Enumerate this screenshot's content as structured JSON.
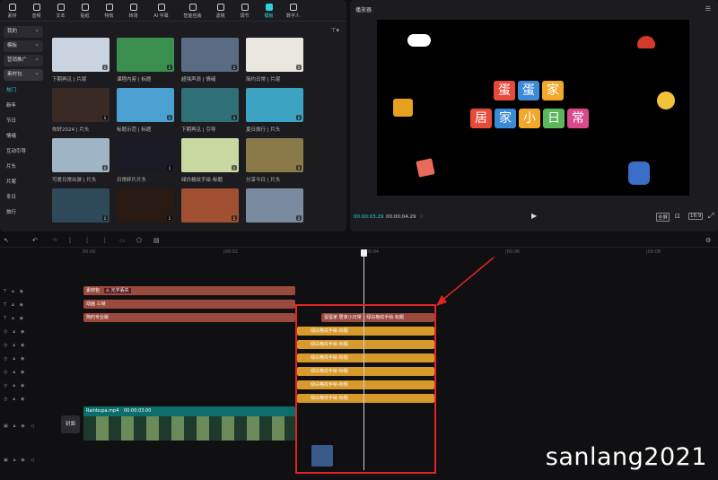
{
  "toolbar": {
    "tabs": [
      {
        "label": "素材",
        "icon": "media-icon"
      },
      {
        "label": "音频",
        "icon": "audio-icon"
      },
      {
        "label": "文本",
        "icon": "text-icon"
      },
      {
        "label": "贴纸",
        "icon": "sticker-icon"
      },
      {
        "label": "特效",
        "icon": "effects-icon"
      },
      {
        "label": "转场",
        "icon": "transition-icon"
      },
      {
        "label": "AI 字幕",
        "icon": "ai-caption-icon"
      },
      {
        "label": "智能包装",
        "icon": "smart-package-icon"
      },
      {
        "label": "滤镜",
        "icon": "filter-icon"
      },
      {
        "label": "调节",
        "icon": "adjust-icon"
      },
      {
        "label": "模板",
        "icon": "template-icon",
        "active": true
      },
      {
        "label": "数字人",
        "icon": "digital-human-icon"
      }
    ]
  },
  "sidebar": {
    "dropdowns": [
      "我的",
      "模板",
      "营销推广",
      "素材包"
    ],
    "items": [
      "热门",
      "新年",
      "节日",
      "情绪",
      "互动引导",
      "片头",
      "片尾",
      "冬日",
      "旅行"
    ]
  },
  "filter_label": "⊤▾",
  "grid": {
    "items": [
      {
        "label": "下期再见 | 片尾",
        "color": "#c9d4e0"
      },
      {
        "label": "课程内容 | 标题",
        "color": "#3b8f4e"
      },
      {
        "label": "超强声浪 | 情绪",
        "color": "#5a6c84"
      },
      {
        "label": "简约日常 | 片尾",
        "color": "#e9e6e0"
      },
      {
        "label": "你好2024 | 片头",
        "color": "#3a2a24"
      },
      {
        "label": "标题示范 | 标题",
        "color": "#4aa0d0"
      },
      {
        "label": "下期再见 | 引导",
        "color": "#2f6f78"
      },
      {
        "label": "夏日旅行 | 片头",
        "color": "#3da3c2"
      },
      {
        "label": "可爱日常出游 | 片头",
        "color": "#9fb4c4"
      },
      {
        "label": "日常碎片片头",
        "color": "#1a1a24"
      },
      {
        "label": "绿白格纹手绘-标题",
        "color": "#c8d8a0"
      },
      {
        "label": "分享今日 | 片头",
        "color": "#8a7a4a"
      },
      {
        "label": "",
        "color": "#2e4a5a"
      },
      {
        "label": "",
        "color": "#2a1a14"
      },
      {
        "label": "",
        "color": "#a05030"
      },
      {
        "label": "",
        "color": "#7a8aa0"
      }
    ]
  },
  "player": {
    "title": "播放器",
    "current_time": "00:00:03:29",
    "total_time": "00:00:04:29",
    "title_line1": "蛋蛋家",
    "title_line2": "居家小日常",
    "ratio_label": "16:9",
    "fullscreen_label": "全屏"
  },
  "timeline": {
    "ruler_ticks": [
      "00:00",
      "|00:02",
      "|00:04",
      "|00:06",
      "|00:08"
    ],
    "tracks": [
      {
        "clips": [
          {
            "label": "素材包",
            "badge": "⚠ 元字丢失",
            "color": "red"
          }
        ]
      },
      {
        "clips": [
          {
            "label": "动画 三帧",
            "color": "red"
          }
        ]
      },
      {
        "clips": [
          {
            "label": "简约专业版",
            "color": "red"
          }
        ]
      }
    ],
    "template_clip_header": "蛋蛋家 居家小日常",
    "template_clip_header2": "绿白格纹手绘-标题",
    "yellow_clip_label": "绿白格纹手绘-标题",
    "video_clip_name": "Rainbupa.mp4",
    "video_clip_duration": "00:00:03:00",
    "cover_label": "封面"
  },
  "watermark": "sanlang2021",
  "colors": {
    "accent": "#2bd3e0",
    "highlight": "#e02424",
    "clip_red": "#9b4a3e",
    "clip_yellow": "#d89a2a",
    "clip_teal": "#0b6e6c"
  }
}
